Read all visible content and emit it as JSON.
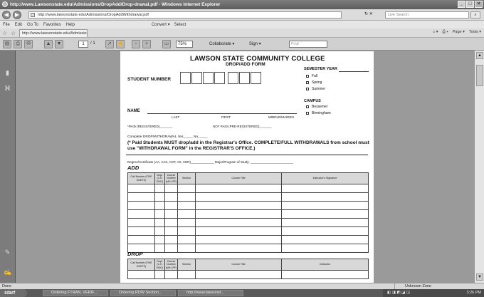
{
  "window": {
    "title": "http://www.Lawsonstate.edu/Admissions/DropAdd/Drop-drawal.pdf - Windows Internet Explorer",
    "controls": [
      "_",
      "□",
      "×"
    ]
  },
  "addressbar": {
    "back": "◀",
    "forward": "▶",
    "url": "http://www.lawsonstate.edu/Admissions/DropAddWithdrawal.pdf",
    "go_controls": "↻ ✕",
    "search_placeholder": "Live Search",
    "search_button": "⌕"
  },
  "menubar": {
    "items": [
      "File",
      "Edit",
      "Go To",
      "Favorites",
      "Help"
    ],
    "convert": "Convert ▾",
    "select": "Select"
  },
  "favbar": {
    "tab_label": "http://www.lawsonstate.edu/Admissions/DropAdd...",
    "commands": [
      "Page ▾",
      "Tools ▾"
    ]
  },
  "pdf_toolbar": {
    "page_current": "1",
    "page_total": "/ 1",
    "zoom": "75%",
    "collaborate": "Collaborate ▾",
    "sign": "Sign ▾",
    "find_placeholder": "Find"
  },
  "form": {
    "title": "LAWSON STATE COMMUNITY COLLEGE",
    "subtitle": "DROP/ADD FORM",
    "student_number_label": "STUDENT NUMBER",
    "semester_year_label": "SEMESTER YEAR",
    "semesters": [
      "Fall",
      "Spring",
      "Summer"
    ],
    "campus_label": "CAMPUS",
    "campuses": [
      "Bessemer",
      "Birmingham"
    ],
    "name_label": "NAME",
    "name_parts": [
      "LAST",
      "FIRST",
      "MIDDLE/MAIDEN"
    ],
    "paid_label": "*PAID (REGISTERED)_______",
    "not_paid_label": "NOT PAID (PRE-REGISTERED)_______",
    "complete_line": "Complete DROP/WITHDRAWAL     Yes_____     No_____",
    "warning": "(* Paid Students MUST drop/add in the Registrar's Office.  COMPLETE/FULL WITHDRAWALS from school must use \"WITHDRAWAL FORM\" in the REGISTRAR'S OFFICE.)",
    "degree_line": "Degree/Certificate (AA, AAS, AOT, AS, CER)_____________     Major/Program of Study: ________________________",
    "add_label": "ADD",
    "drop_label": "DROP",
    "columns": [
      "Call Number (FIVE DIGITS)",
      "Dept. (C.E. ENG)",
      "Course Number (MH 1PF)",
      "Section",
      "Course Title",
      "Instructor's Signature"
    ],
    "drop_columns": [
      "Call Number (FIVE DIGITS)",
      "Dept. (C.E. ENG)",
      "Course Number (MH 1PF)",
      "Section",
      "Course Title",
      "Instructor"
    ]
  },
  "statusbar": {
    "left": "Done",
    "zone": "Unknown Zone"
  },
  "taskbar": {
    "start": "start",
    "tasks": [
      "Ordering FTRAN, VERIF...",
      "Ordering RDW Section...",
      "http://www.lawsonst..."
    ],
    "clock": "3:26 PM"
  }
}
